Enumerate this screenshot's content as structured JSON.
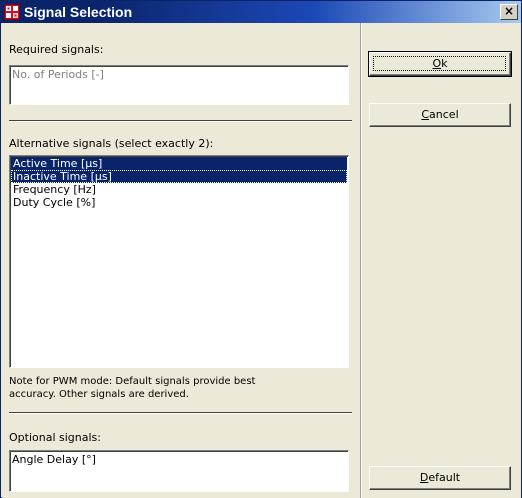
{
  "window": {
    "title": "Signal Selection",
    "close_glyph": "×"
  },
  "required": {
    "label": "Required signals:",
    "value": "No. of Periods [-]"
  },
  "alternative": {
    "label": "Alternative signals (select exactly 2):",
    "items": [
      {
        "label": "Active Time [µs]",
        "selected": true
      },
      {
        "label": "Inactive Time [µs]",
        "selected": true
      },
      {
        "label": "Frequency [Hz]",
        "selected": false
      },
      {
        "label": "Duty Cycle [%]",
        "selected": false
      }
    ],
    "note": [
      "Note for PWM mode: Default signals provide best",
      "accuracy. Other signals are derived."
    ]
  },
  "optional": {
    "label": "Optional signals:",
    "value": "Angle Delay [°]"
  },
  "buttons": {
    "ok": {
      "mnemonic": "O",
      "rest": "k"
    },
    "cancel": {
      "mnemonic": "C",
      "rest": "ancel"
    },
    "default": {
      "mnemonic": "D",
      "rest": "efault"
    }
  },
  "colors": {
    "titlebar": "#0a246a",
    "selection": "#0a246a",
    "face": "#ece9d8"
  },
  "icons": {
    "app": "signal-grid-icon",
    "close": "close-icon"
  }
}
